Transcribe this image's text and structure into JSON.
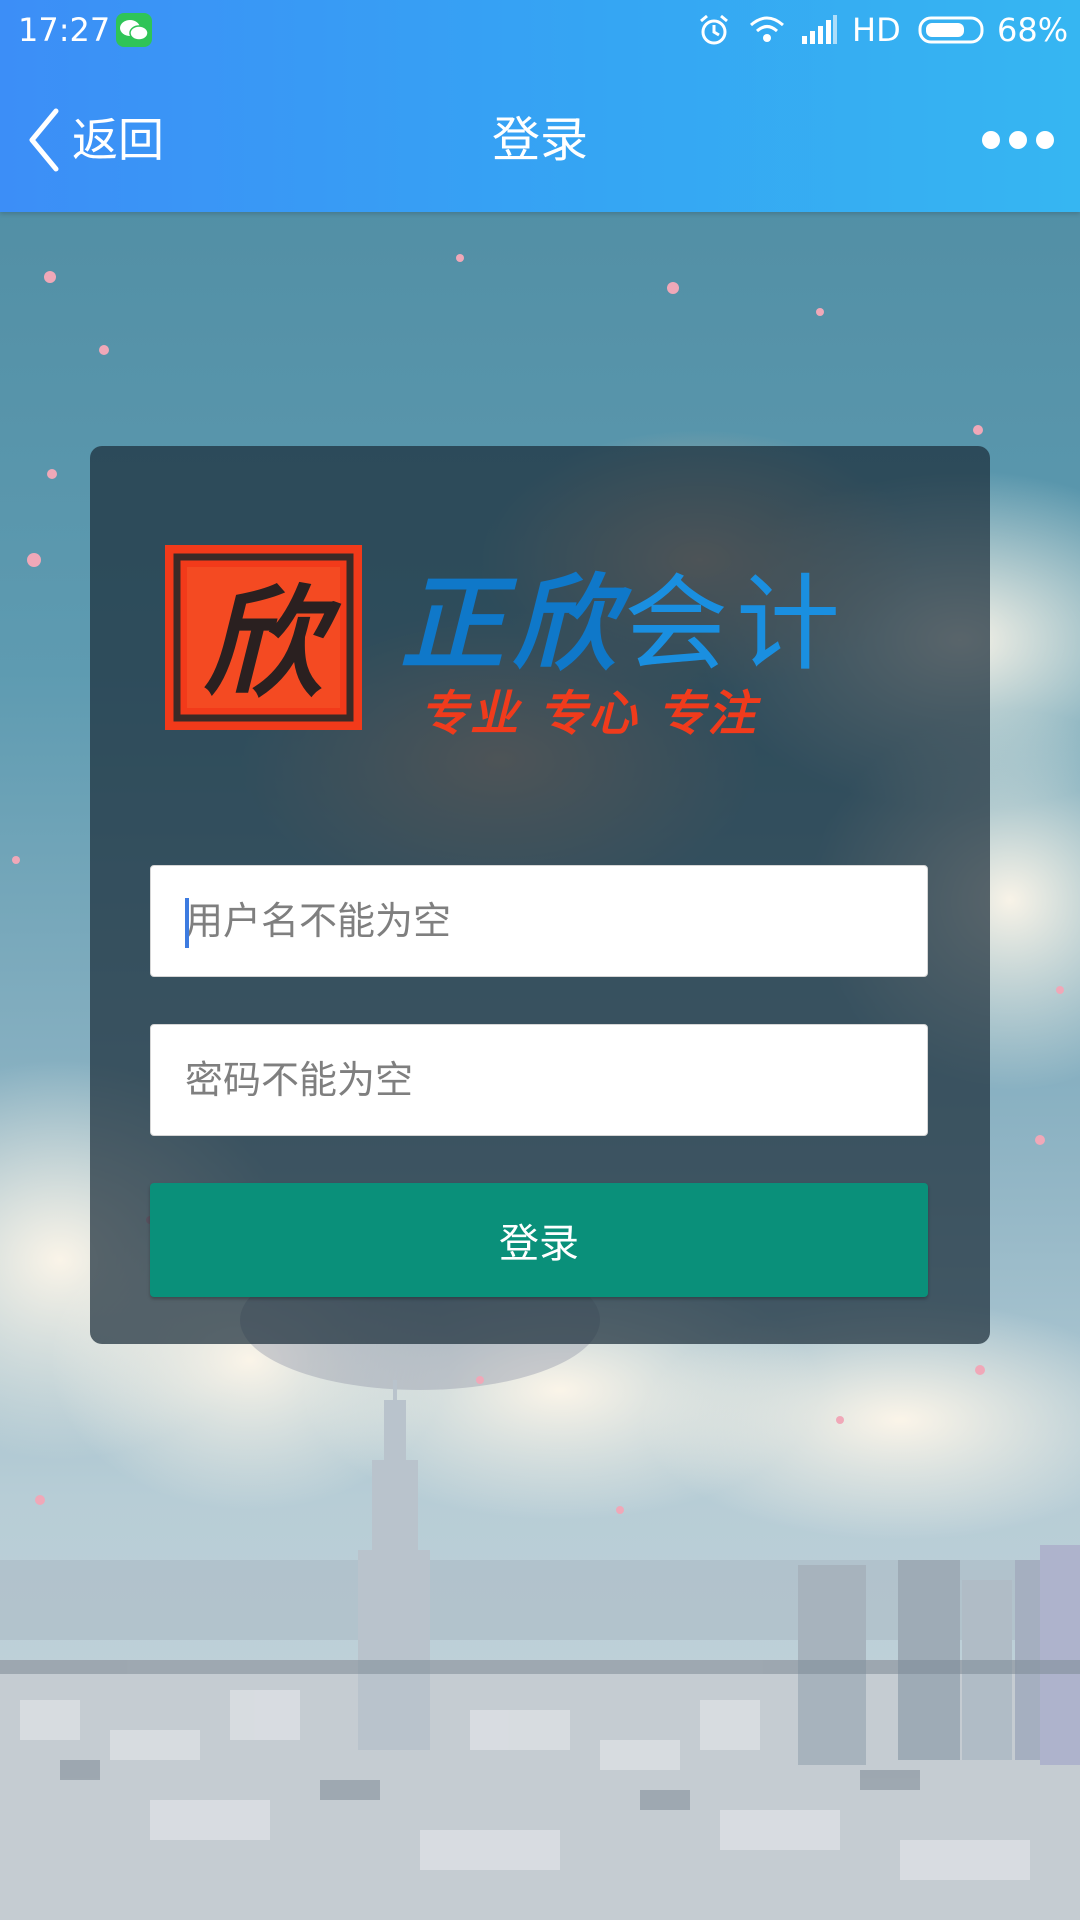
{
  "status_bar": {
    "time": "17:27",
    "network": "HD",
    "battery": "68%"
  },
  "nav": {
    "back_label": "返回",
    "title": "登录"
  },
  "brand": {
    "logo_char": "欣",
    "name_part1": "正欣",
    "name_part2": "会计",
    "slogan": "专业 专心 专注"
  },
  "form": {
    "username_placeholder": "用户名不能为空",
    "password_placeholder": "密码不能为空",
    "submit_label": "登录"
  },
  "colors": {
    "nav_bar": "#36a0f4",
    "login_button": "#0a907a",
    "brand_blue": "#1a8fe0",
    "slogan_red": "#f03b1c",
    "seal_red": "#f23a1a"
  }
}
